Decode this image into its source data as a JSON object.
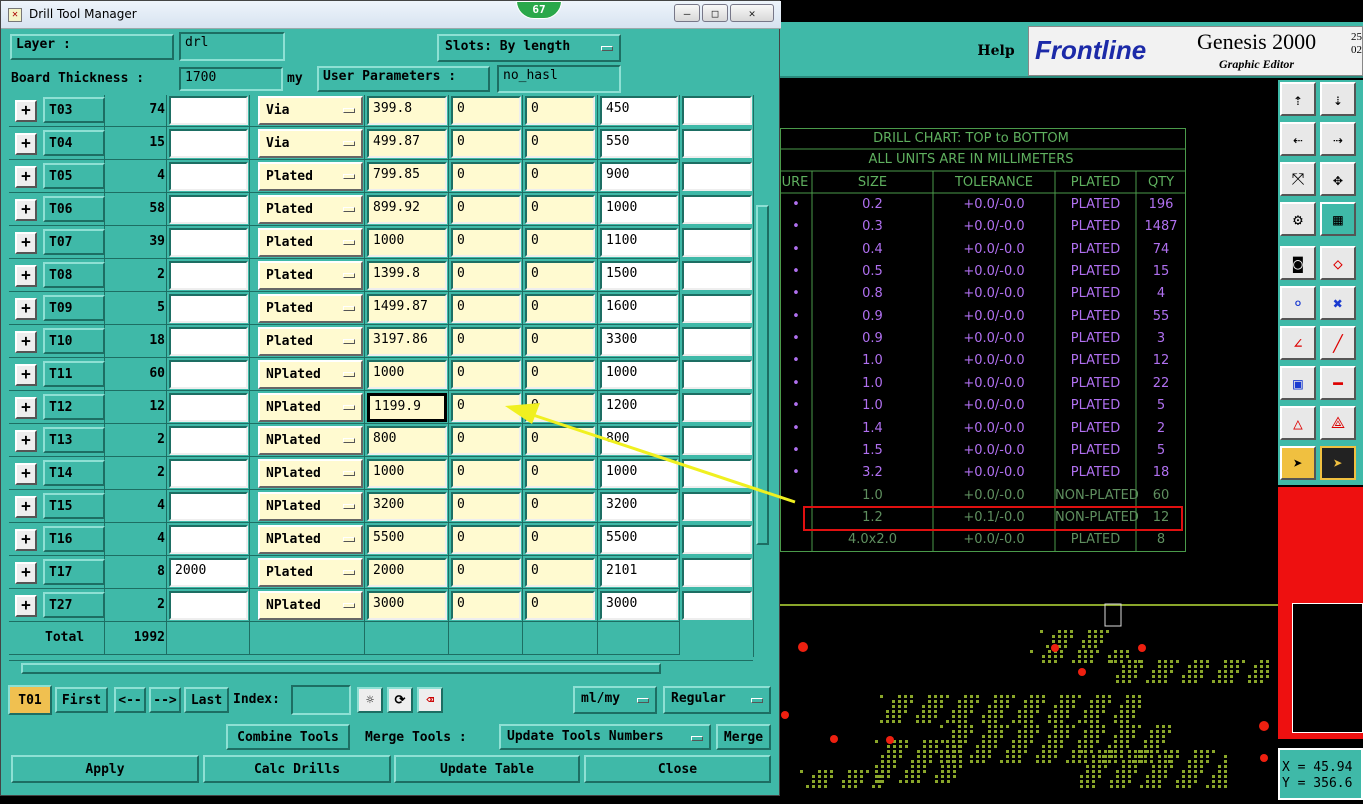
{
  "window": {
    "title": "Drill Tool Manager",
    "minimize": "—",
    "maximize": "□",
    "close": "✕",
    "badge": "67"
  },
  "header": {
    "layer_label": "Layer         :",
    "layer_value": "drl",
    "slots_label": "Slots:",
    "slots_value": "By length",
    "thickness_label": "Board Thickness :",
    "thickness_value": "1700",
    "thickness_unit": "my",
    "user_params_label": "User Parameters :",
    "user_params_value": "no_hasl"
  },
  "rows": [
    {
      "name": "T03",
      "count": "74",
      "c1": "",
      "type": "Via",
      "size": "399.8",
      "tp": "0",
      "tm": "0",
      "fin": "450",
      "extra": ""
    },
    {
      "name": "T04",
      "count": "15",
      "c1": "",
      "type": "Via",
      "size": "499.87",
      "tp": "0",
      "tm": "0",
      "fin": "550",
      "extra": ""
    },
    {
      "name": "T05",
      "count": "4",
      "c1": "",
      "type": "Plated",
      "size": "799.85",
      "tp": "0",
      "tm": "0",
      "fin": "900",
      "extra": ""
    },
    {
      "name": "T06",
      "count": "58",
      "c1": "",
      "type": "Plated",
      "size": "899.92",
      "tp": "0",
      "tm": "0",
      "fin": "1000",
      "extra": ""
    },
    {
      "name": "T07",
      "count": "39",
      "c1": "",
      "type": "Plated",
      "size": "1000",
      "tp": "0",
      "tm": "0",
      "fin": "1100",
      "extra": ""
    },
    {
      "name": "T08",
      "count": "2",
      "c1": "",
      "type": "Plated",
      "size": "1399.8",
      "tp": "0",
      "tm": "0",
      "fin": "1500",
      "extra": ""
    },
    {
      "name": "T09",
      "count": "5",
      "c1": "",
      "type": "Plated",
      "size": "1499.87",
      "tp": "0",
      "tm": "0",
      "fin": "1600",
      "extra": ""
    },
    {
      "name": "T10",
      "count": "18",
      "c1": "",
      "type": "Plated",
      "size": "3197.86",
      "tp": "0",
      "tm": "0",
      "fin": "3300",
      "extra": ""
    },
    {
      "name": "T11",
      "count": "60",
      "c1": "",
      "type": "NPlated",
      "size": "1000",
      "tp": "0",
      "tm": "0",
      "fin": "1000",
      "extra": ""
    },
    {
      "name": "T12",
      "count": "12",
      "c1": "",
      "type": "NPlated",
      "size": "1199.9",
      "tp": "0",
      "tm": "0",
      "fin": "1200",
      "extra": ""
    },
    {
      "name": "T13",
      "count": "2",
      "c1": "",
      "type": "NPlated",
      "size": "800",
      "tp": "0",
      "tm": "0",
      "fin": "800",
      "extra": ""
    },
    {
      "name": "T14",
      "count": "2",
      "c1": "",
      "type": "NPlated",
      "size": "1000",
      "tp": "0",
      "tm": "0",
      "fin": "1000",
      "extra": ""
    },
    {
      "name": "T15",
      "count": "4",
      "c1": "",
      "type": "NPlated",
      "size": "3200",
      "tp": "0",
      "tm": "0",
      "fin": "3200",
      "extra": ""
    },
    {
      "name": "T16",
      "count": "4",
      "c1": "",
      "type": "NPlated",
      "size": "5500",
      "tp": "0",
      "tm": "0",
      "fin": "5500",
      "extra": ""
    },
    {
      "name": "T17",
      "count": "8",
      "c1": "2000",
      "type": "Plated",
      "size": "2000",
      "tp": "0",
      "tm": "0",
      "fin": "2101",
      "extra": ""
    },
    {
      "name": "T27",
      "count": "2",
      "c1": "",
      "type": "NPlated",
      "size": "3000",
      "tp": "0",
      "tm": "0",
      "fin": "3000",
      "extra": ""
    }
  ],
  "total": {
    "label": "Total",
    "value": "1992"
  },
  "nav": {
    "current": "T01",
    "first": "First",
    "prev": "<--",
    "next": "-->",
    "last": "Last",
    "index_label": "Index:",
    "units": "ml/my",
    "mode": "Regular"
  },
  "actions": {
    "combine": "Combine Tools",
    "merge_label": "Merge Tools :",
    "merge_option": "Update Tools Numbers",
    "merge": "Merge"
  },
  "bottom": {
    "apply": "Apply",
    "calc": "Calc Drills",
    "update": "Update Table",
    "close": "Close"
  },
  "genesis": {
    "help": "Help",
    "brand": "Frontline",
    "product": "Genesis 2000",
    "subtitle": "Graphic Editor",
    "version_top": "25",
    "version_bottom": "02"
  },
  "drill_chart": {
    "title1": "DRILL CHART: TOP to BOTTOM",
    "title2": "ALL UNITS ARE IN MILLIMETERS",
    "headers": [
      "URE",
      "SIZE",
      "TOLERANCE",
      "PLATED",
      "QTY"
    ],
    "rows": [
      {
        "sym": "•",
        "size": "0.2",
        "tol": "+0.0/-0.0",
        "plated": "PLATED",
        "qty": "196"
      },
      {
        "sym": "•",
        "size": "0.3",
        "tol": "+0.0/-0.0",
        "plated": "PLATED",
        "qty": "1487"
      },
      {
        "sym": "•",
        "size": "0.4",
        "tol": "+0.0/-0.0",
        "plated": "PLATED",
        "qty": "74"
      },
      {
        "sym": "•",
        "size": "0.5",
        "tol": "+0.0/-0.0",
        "plated": "PLATED",
        "qty": "15"
      },
      {
        "sym": "•",
        "size": "0.8",
        "tol": "+0.0/-0.0",
        "plated": "PLATED",
        "qty": "4"
      },
      {
        "sym": "•",
        "size": "0.9",
        "tol": "+0.0/-0.0",
        "plated": "PLATED",
        "qty": "55"
      },
      {
        "sym": "•",
        "size": "0.9",
        "tol": "+0.0/-0.0",
        "plated": "PLATED",
        "qty": "3"
      },
      {
        "sym": "•",
        "size": "1.0",
        "tol": "+0.0/-0.0",
        "plated": "PLATED",
        "qty": "12"
      },
      {
        "sym": "•",
        "size": "1.0",
        "tol": "+0.0/-0.0",
        "plated": "PLATED",
        "qty": "22"
      },
      {
        "sym": "•",
        "size": "1.0",
        "tol": "+0.0/-0.0",
        "plated": "PLATED",
        "qty": "5"
      },
      {
        "sym": "•",
        "size": "1.4",
        "tol": "+0.0/-0.0",
        "plated": "PLATED",
        "qty": "2"
      },
      {
        "sym": "•",
        "size": "1.5",
        "tol": "+0.0/-0.0",
        "plated": "PLATED",
        "qty": "5"
      },
      {
        "sym": "•",
        "size": "3.2",
        "tol": "+0.0/-0.0",
        "plated": "PLATED",
        "qty": "18"
      },
      {
        "sym": "",
        "size": "1.0",
        "tol": "+0.0/-0.0",
        "plated": "NON-PLATED",
        "qty": "60"
      },
      {
        "sym": "",
        "size": "1.2",
        "tol": "+0.1/-0.0",
        "plated": "NON-PLATED",
        "qty": "12"
      },
      {
        "sym": "",
        "size": "4.0x2.0",
        "tol": "+0.0/-0.0",
        "plated": "PLATED",
        "qty": "8"
      }
    ]
  },
  "coords": {
    "x": "X = 45.94",
    "y": "Y = 356.6"
  },
  "colors": {
    "panel": "#3fb9a8",
    "highlight": "#e01010",
    "arrow": "#f0f020",
    "chart_text": "#b070f0"
  }
}
